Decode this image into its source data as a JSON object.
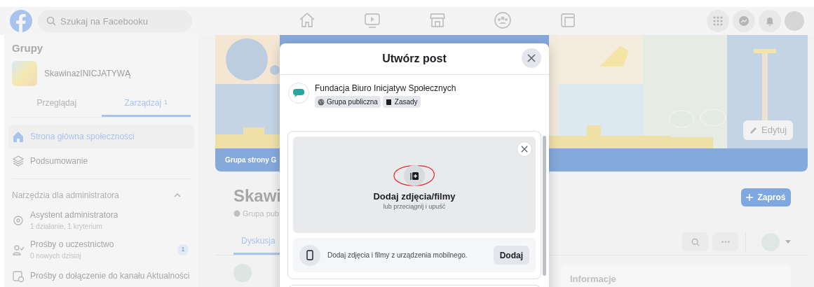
{
  "top_bar": {
    "search": {
      "placeholder": "Szukaj na Facebooku"
    }
  },
  "sidebar": {
    "title": "Grupy",
    "group_name": "SkawinazINICJATYWĄ",
    "tabs": [
      {
        "label": "Przeglądaj",
        "selected": false
      },
      {
        "label": "Zarządzaj",
        "count": "1",
        "selected": true
      }
    ],
    "items": [
      {
        "kind": "home",
        "label": "Strona główna społeczności",
        "selected": true
      },
      {
        "kind": "summary",
        "label": "Podsumowanie",
        "selected": false
      }
    ],
    "admin_section": {
      "title": "Narzędzia dla administratora",
      "expanded": true,
      "items": [
        {
          "kind": "assistant",
          "label": "Asystent administratora",
          "subtitle": "1 działanie, 1 kryterium"
        },
        {
          "kind": "members",
          "label": "Prośby o uczestnictwo",
          "subtitle": "0 nowych dzisiaj",
          "badge": "1"
        },
        {
          "kind": "feed",
          "label": "Prośby o dołączenie do kanału Aktualności"
        }
      ]
    }
  },
  "group_page": {
    "cover_caption": "Grupa strony G",
    "edit_button": "Edytuj",
    "name": "Skawi",
    "privacy": "Grupa pub",
    "invite_button": "Zaproś",
    "tabs": [
      {
        "label": "Dyskusja",
        "selected": true
      }
    ],
    "about_card": {
      "title": "Informacje"
    }
  },
  "dialog": {
    "title": "Utwórz post",
    "author": {
      "name": "Fundacja Biuro Inicjatyw Społecznych",
      "badges": [
        {
          "kind": "privacy",
          "label": "Grupa publiczna"
        },
        {
          "kind": "rules",
          "label": "Zasady"
        }
      ]
    },
    "upload": {
      "title": "Dodaj zdjęcia/filmy",
      "subtitle": "lub przeciągnij i upuść"
    },
    "mobile": {
      "text": "Dodaj zdjęcia i filmy z urządzenia mobilnego.",
      "button": "Dodaj"
    }
  }
}
